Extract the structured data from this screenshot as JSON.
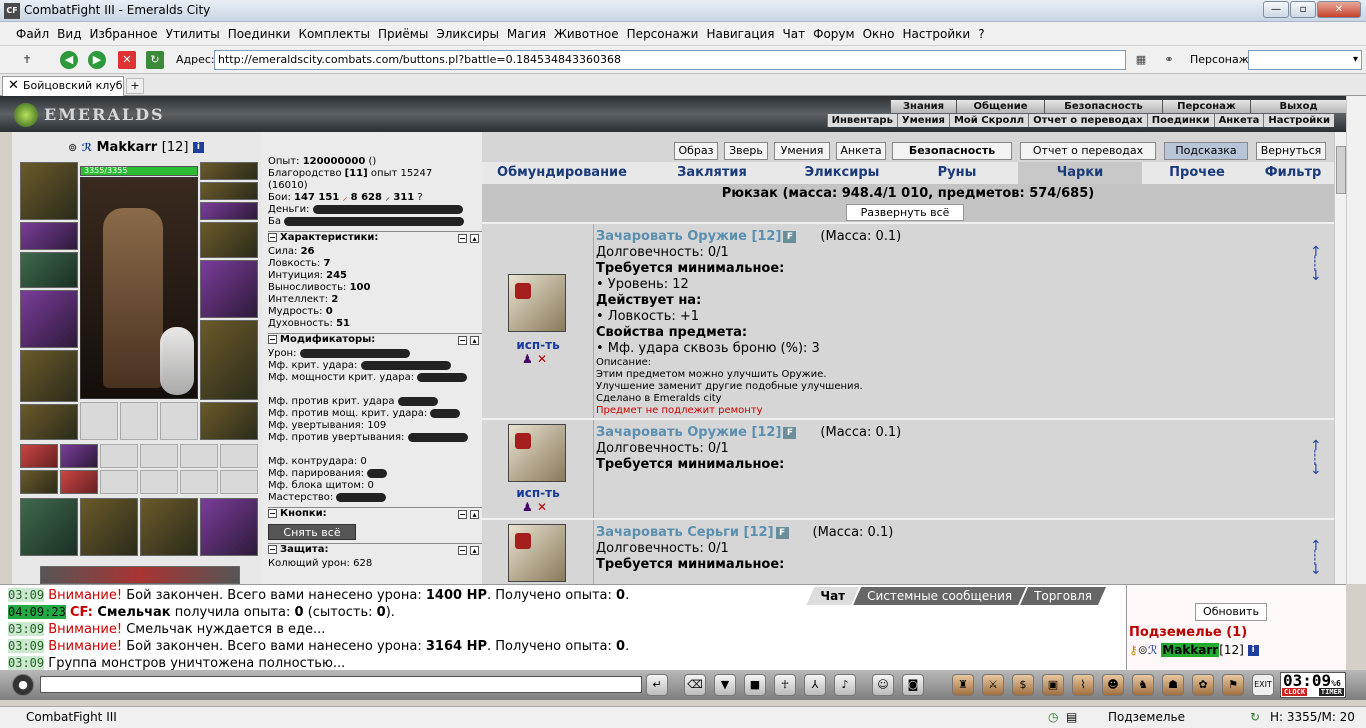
{
  "window": {
    "title": "CombatFight III - Emeralds City",
    "app_icon": "CF"
  },
  "menu": [
    "Файл",
    "Вид",
    "Избранное",
    "Утилиты",
    "Поединки",
    "Комплекты",
    "Приёмы",
    "Эликсиры",
    "Магия",
    "Животное",
    "Персонажи",
    "Навигация",
    "Чат",
    "Форум",
    "Окно",
    "Настройки",
    "?"
  ],
  "address": {
    "label": "Адрес:",
    "url": "http://emeraldscity.combats.com/buttons.pl?battle=0.184534843360368",
    "pers_label": "Персонаж:",
    "pers_value": ""
  },
  "tab": {
    "label": "Бойцовский клуб"
  },
  "game_nav": {
    "top": [
      "Знания",
      "Общение",
      "Безопасность",
      "Персонаж",
      "Выход"
    ],
    "bottom": [
      "Инвентарь",
      "Умения",
      "Мой Скролл",
      "Отчет о переводах",
      "Поединки",
      "Анкета",
      "Настройки"
    ]
  },
  "logo_text": "EMERALDS",
  "character": {
    "name": "Makkarr",
    "level": "[12]",
    "hp": "3355/3355"
  },
  "stats": {
    "exp": "Опыт:",
    "exp_val": "120000000",
    "exp_suffix": "()",
    "blago": "Благородство",
    "blago_lvl": "[11]",
    "blago_rest": "опыт 15247",
    "blago_sub": "(16010)",
    "fights": "Бои:",
    "fights_w": "147 151",
    "fights_l": "8 628",
    "fights_d": "311",
    "money": "Деньги:",
    "bank": "Ба",
    "char_hdr": "Характеристики:",
    "char_rows": [
      {
        "k": "Сила:",
        "v": "26"
      },
      {
        "k": "Ловкость:",
        "v": "7"
      },
      {
        "k": "Интуиция:",
        "v": "245"
      },
      {
        "k": "Выносливость:",
        "v": "100"
      },
      {
        "k": "Интеллект:",
        "v": "2"
      },
      {
        "k": "Мудрость:",
        "v": "0"
      },
      {
        "k": "Духовность:",
        "v": "51"
      }
    ],
    "mod_hdr": "Модификаторы:",
    "mod_rows": [
      "Урон:",
      "Мф. крит. удара:",
      "Мф. мощности крит. удара:",
      "",
      "Мф. против крит. удара",
      "Мф. против мощ. крит. удара:",
      "Мф. увертывания: 109",
      "Мф. против увертывания:",
      "",
      "Мф. контрудара: 0",
      "Мф. парирования:",
      "Мф. блока щитом: 0",
      "Мастерство:"
    ],
    "btn_hdr": "Кнопки:",
    "btn_unequip": "Снять всё",
    "def_hdr": "Защита:",
    "def_rows": [
      "Колющий урон: 628"
    ]
  },
  "inventory": {
    "top_buttons": [
      "Образ",
      "Зверь",
      "Умения",
      "Анкета",
      "Безопасность",
      "Отчет о переводах",
      "Подсказка",
      "Вернуться"
    ],
    "tabs": [
      "Обмундирование",
      "Заклятия",
      "Эликсиры",
      "Руны",
      "Чарки",
      "Прочее",
      "Фильтр"
    ],
    "bag_title": "Рюкзак (масса: 948.4/1 010, предметов: 574/685)",
    "expand": "Развернуть всё",
    "items": [
      {
        "name": "Зачаровать Оружие [12]",
        "mass": "(Масса: 0.1)",
        "dur": "Долговечность: 0/1",
        "req": "Требуется минимальное:",
        "req_rows": [
          "• Уровень: 12"
        ],
        "act": "Действует на:",
        "act_rows": [
          "• Ловкость: +1"
        ],
        "props": "Свойства предмета:",
        "props_rows": [
          "• Мф. удара сквозь броню (%): 3"
        ],
        "desc": [
          "Описание:",
          "Этим предметом можно улучшить Оружие.",
          "Улучшение заменит другие подобные улучшения.",
          "Сделано в Emeralds city"
        ],
        "norepair": "Предмет не подлежит ремонту",
        "use": "исп-ть"
      },
      {
        "name": "Зачаровать Оружие [12]",
        "mass": "(Масса: 0.1)",
        "dur": "Долговечность: 0/1",
        "req": "Требуется минимальное:",
        "use": "исп-ть"
      },
      {
        "name": "Зачаровать Серьги [12]",
        "mass": "(Масса: 0.1)",
        "dur": "Долговечность: 0/1",
        "req": "Требуется минимальное:",
        "use": ""
      }
    ]
  },
  "chat": {
    "tabs": [
      "Чат",
      "Системные сообщения",
      "Торговля"
    ],
    "messages": [
      {
        "time": "03:09",
        "pre": "Внимание!",
        "text": " Бой закончен. Всего вами нанесено урона: ",
        "b1": "1400 HP",
        "mid": ". Получено опыта: ",
        "b2": "0",
        "end": "."
      },
      {
        "time": "04:09:23",
        "cf": "CF:",
        "b0": " Смельчак",
        "text": " получила опыта: ",
        "b1": "0",
        "mid": " (сытость: ",
        "b2": "0",
        "end": ")."
      },
      {
        "time": "03:09",
        "pre": "Внимание!",
        "text": " Смельчак нуждается в еде..."
      },
      {
        "time": "03:09",
        "pre": "Внимание!",
        "text": " Бой закончен. Всего вами нанесено урона: ",
        "b1": "3164 HP",
        "mid": ". Получено опыта: ",
        "b2": "0",
        "end": "."
      },
      {
        "time": "03:09",
        "text": "Группа монстров уничтожена полностью..."
      }
    ]
  },
  "right_panel": {
    "refresh": "Обновить",
    "location": "Подземелье (1)",
    "player": "Makkarr",
    "player_lvl": "[12]"
  },
  "clock": {
    "time": "03:09",
    "pct": "%6",
    "label1": "CLOCK",
    "label2": "TIMER"
  },
  "status": {
    "app": "CombatFight III",
    "location": "Подземелье",
    "hm": "H: 3355/M: 20"
  },
  "colors": {
    "accent": "#1a3a7a",
    "hp": "#2cbd34",
    "warn": "#cc0000"
  }
}
